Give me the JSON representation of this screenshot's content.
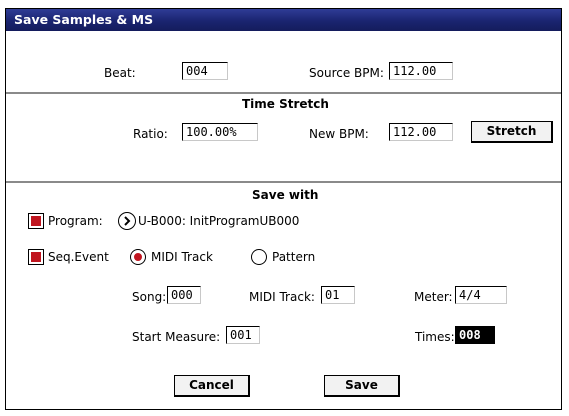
{
  "dialog": {
    "title": "Save Samples & MS"
  },
  "beat": {
    "label": "Beat:",
    "value": "004"
  },
  "source_bpm": {
    "label": "Source BPM:",
    "value": "112.00"
  },
  "time_stretch": {
    "heading": "Time Stretch",
    "ratio_label": "Ratio:",
    "ratio_value": "100.00%",
    "new_bpm_label": "New BPM:",
    "new_bpm_value": "112.00",
    "stretch_button": "Stretch"
  },
  "save_with": {
    "heading": "Save with",
    "program_label": "Program:",
    "program_checked": true,
    "program_value": "U-B000: InitProgramUB000",
    "seq_event_label": "Seq.Event",
    "seq_event_checked": true,
    "midi_track_option": "MIDI Track",
    "pattern_option": "Pattern",
    "selected_option": "MIDI Track"
  },
  "song": {
    "label": "Song:",
    "value": "000"
  },
  "midi_track": {
    "label": "MIDI Track:",
    "value": "01"
  },
  "meter": {
    "label": "Meter:",
    "value": "4/4"
  },
  "start_measure": {
    "label": "Start Measure:",
    "value": "001"
  },
  "times": {
    "label": "Times:",
    "value": "008"
  },
  "buttons": {
    "cancel": "Cancel",
    "save": "Save"
  },
  "colors": {
    "title_bar": "#1a2470",
    "check_mark": "#c0151f",
    "radio_dot": "#c0151f"
  }
}
